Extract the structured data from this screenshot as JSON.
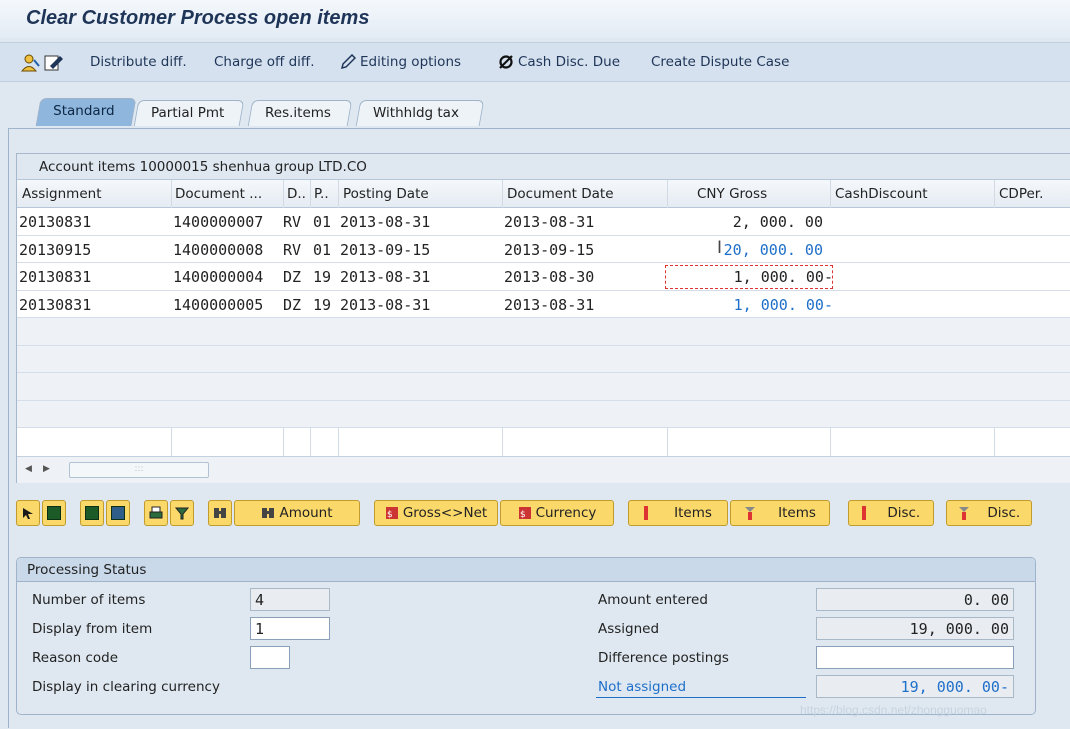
{
  "window": {
    "title": "Clear Customer Process open items"
  },
  "toolbar": {
    "items": [
      {
        "label": "Distribute diff."
      },
      {
        "label": "Charge off diff."
      },
      {
        "label": "Editing options"
      },
      {
        "label": "Cash Disc. Due"
      },
      {
        "label": "Create Dispute Case"
      }
    ]
  },
  "tabs": [
    "Standard",
    "Partial Pmt",
    "Res.items",
    "Withhldg tax"
  ],
  "grid": {
    "title": "Account items 10000015 shenhua group LTD.CO",
    "columns": [
      "Assignment",
      "Document ...",
      "D..",
      "P..",
      "Posting Date",
      "Document Date",
      "CNY Gross",
      "CashDiscount",
      "CDPer."
    ],
    "rows": [
      {
        "assignment": "20130831",
        "document": "1400000007",
        "d": "RV",
        "p": "01",
        "posting_date": "2013-08-31",
        "document_date": "2013-08-31",
        "gross": "2, 000. 00"
      },
      {
        "assignment": "20130915",
        "document": "1400000008",
        "d": "RV",
        "p": "01",
        "posting_date": "2013-09-15",
        "document_date": "2013-09-15",
        "gross": "20, 000. 00"
      },
      {
        "assignment": "20130831",
        "document": "1400000004",
        "d": "DZ",
        "p": "19",
        "posting_date": "2013-08-31",
        "document_date": "2013-08-30",
        "gross": "1, 000. 00-"
      },
      {
        "assignment": "20130831",
        "document": "1400000005",
        "d": "DZ",
        "p": "19",
        "posting_date": "2013-08-31",
        "document_date": "2013-08-31",
        "gross": "1, 000. 00-"
      }
    ]
  },
  "buttons": {
    "amount": "Amount",
    "gross_net": "Gross<>Net",
    "currency": "Currency",
    "items1": "Items",
    "items2": "Items",
    "disc1": "Disc.",
    "disc2": "Disc."
  },
  "status": {
    "title": "Processing Status",
    "number_of_items_label": "Number of items",
    "number_of_items": "4",
    "display_from_label": "Display from item",
    "display_from": "1",
    "reason_code_label": "Reason code",
    "display_currency_label": "Display in clearing currency",
    "amount_entered_label": "Amount entered",
    "amount_entered": "0. 00",
    "assigned_label": "Assigned",
    "assigned": "19, 000. 00",
    "difference_label": "Difference postings",
    "not_assigned_label": "Not assigned",
    "not_assigned": "19, 000. 00-"
  },
  "watermark": "https://blog.csdn.net/zhongguomao",
  "colors": {
    "title": "#1f3558",
    "link_blue": "#1e6fc9",
    "button_yellow": "#fad86a",
    "tab_active": "#8fb6dd"
  }
}
